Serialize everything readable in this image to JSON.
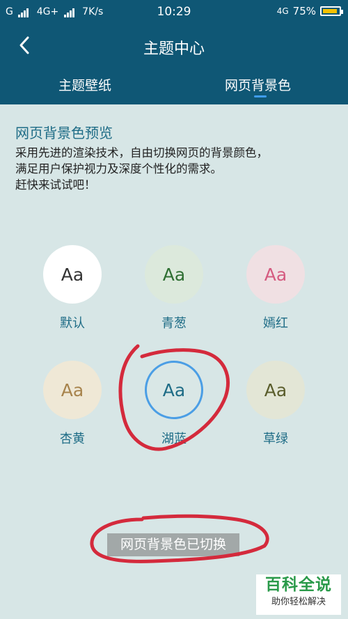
{
  "status_bar": {
    "carrier": "G",
    "network": "4G+",
    "speed": "7K/s",
    "time": "10:29",
    "network_right": "4G",
    "battery": "75%"
  },
  "header": {
    "title": "主题中心",
    "tabs": [
      {
        "label": "主题壁纸"
      },
      {
        "label": "网页背景色"
      }
    ]
  },
  "main": {
    "section_title": "网页背景色预览",
    "description": [
      "采用先进的渲染技术，自由切换网页的背景颜色，",
      "满足用户保护视力及深度个性化的需求。",
      "赶快来试试吧！"
    ],
    "themes": [
      {
        "sample": "Aa",
        "label": "默认",
        "bg": "#ffffff",
        "fg": "#333333"
      },
      {
        "sample": "Aa",
        "label": "青葱",
        "bg": "#dce9dc",
        "fg": "#2f6f33"
      },
      {
        "sample": "Aa",
        "label": "嫣红",
        "bg": "#f0e0e3",
        "fg": "#d55b80"
      },
      {
        "sample": "Aa",
        "label": "杏黄",
        "bg": "#efe8d6",
        "fg": "#a7834c"
      },
      {
        "sample": "Aa",
        "label": "湖蓝",
        "bg": "#d9e7e6",
        "fg": "#1e6c86"
      },
      {
        "sample": "Aa",
        "label": "草绿",
        "bg": "#e3e6d6",
        "fg": "#5a5d2c"
      }
    ],
    "selected_theme": "湖蓝",
    "toast": "网页背景色已切换"
  },
  "watermark": {
    "line1": "百科全说",
    "line2": "助你轻松解决"
  },
  "colors": {
    "header_bg": "#0f5775",
    "accent": "#1e6c86",
    "content_bg": "#d7e6e6",
    "annotation": "#d42a3c"
  }
}
